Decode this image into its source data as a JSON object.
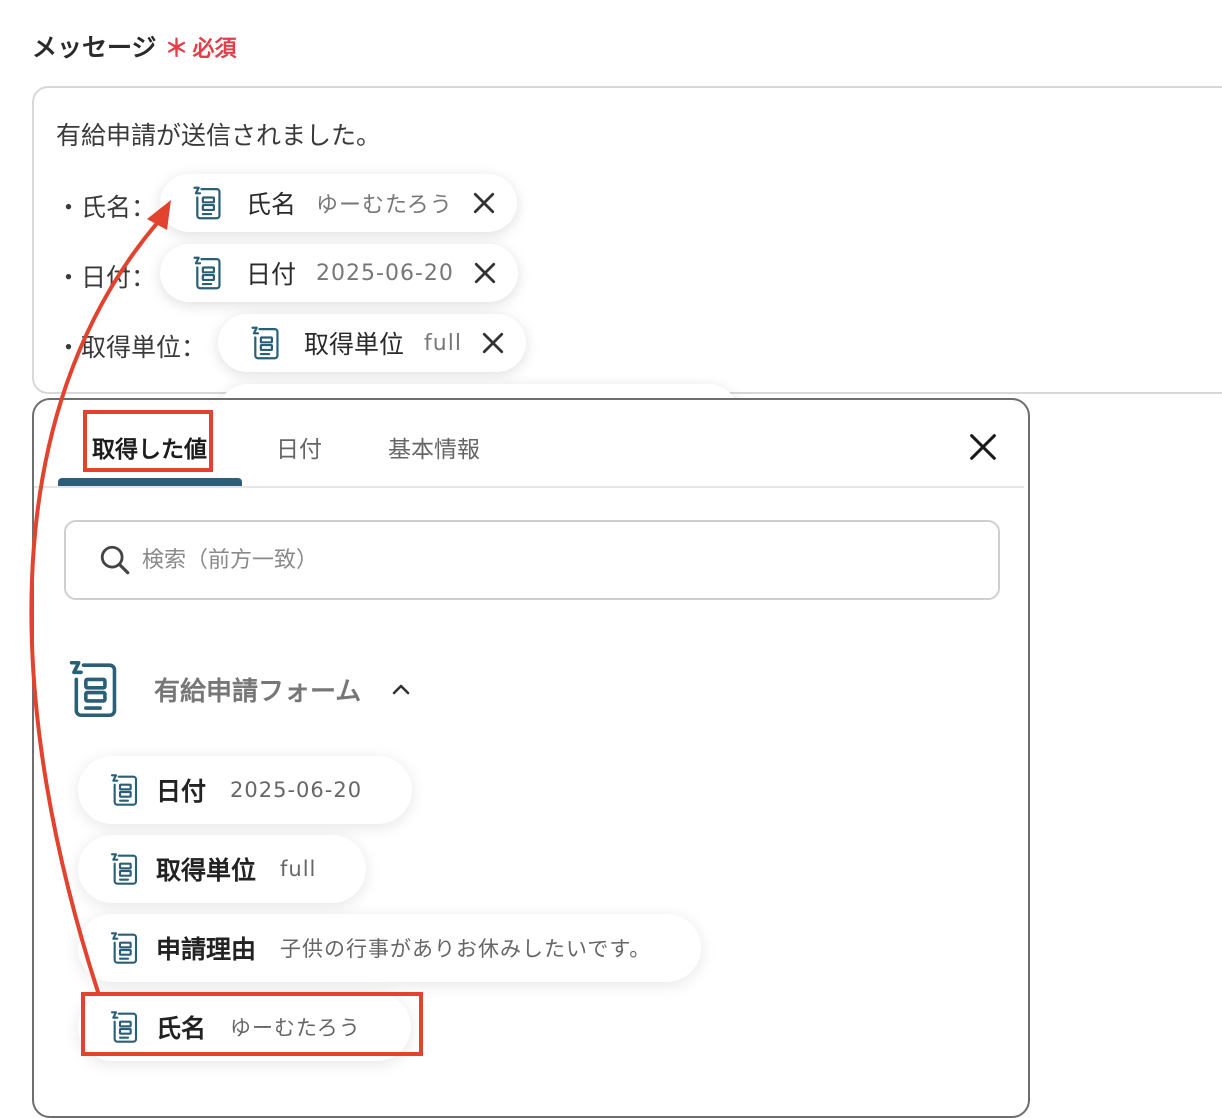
{
  "field": {
    "label": "メッセージ",
    "required_mark": "＊",
    "required_text": "必須"
  },
  "message": {
    "line1": "有給申請が送信されました。",
    "line2_prefix": "・氏名：",
    "line3_prefix": "・日付：",
    "line4_prefix": "・取得単位："
  },
  "chips": [
    {
      "name": "氏名",
      "value": "ゆーむたろう",
      "icon": "form-icon",
      "remove_icon": "close-icon"
    },
    {
      "name": "日付",
      "value": "2025-06-20",
      "icon": "form-icon",
      "remove_icon": "close-icon"
    },
    {
      "name": "取得単位",
      "value": "full",
      "icon": "form-icon",
      "remove_icon": "close-icon"
    }
  ],
  "popup": {
    "tabs": [
      {
        "label": "取得した値",
        "active": true
      },
      {
        "label": "日付",
        "active": false
      },
      {
        "label": "基本情報",
        "active": false
      }
    ],
    "close_icon": "close-icon",
    "search": {
      "placeholder": "検索（前方一致）",
      "value": "",
      "icon": "search-icon"
    },
    "group": {
      "name": "有給申請フォーム",
      "expanded": true,
      "icon": "form-icon",
      "toggle_icon": "chevron-up-icon"
    },
    "options": [
      {
        "name": "日付",
        "value": "2025-06-20"
      },
      {
        "name": "取得単位",
        "value": "full"
      },
      {
        "name": "申請理由",
        "value": "子供の行事がありお休みしたいです。"
      },
      {
        "name": "氏名",
        "value": "ゆーむたろう"
      }
    ]
  },
  "colors": {
    "accent_tab": "#2c5e7a",
    "highlight": "#e1432f",
    "required": "#e0404a",
    "icon": "#2a5f78"
  }
}
